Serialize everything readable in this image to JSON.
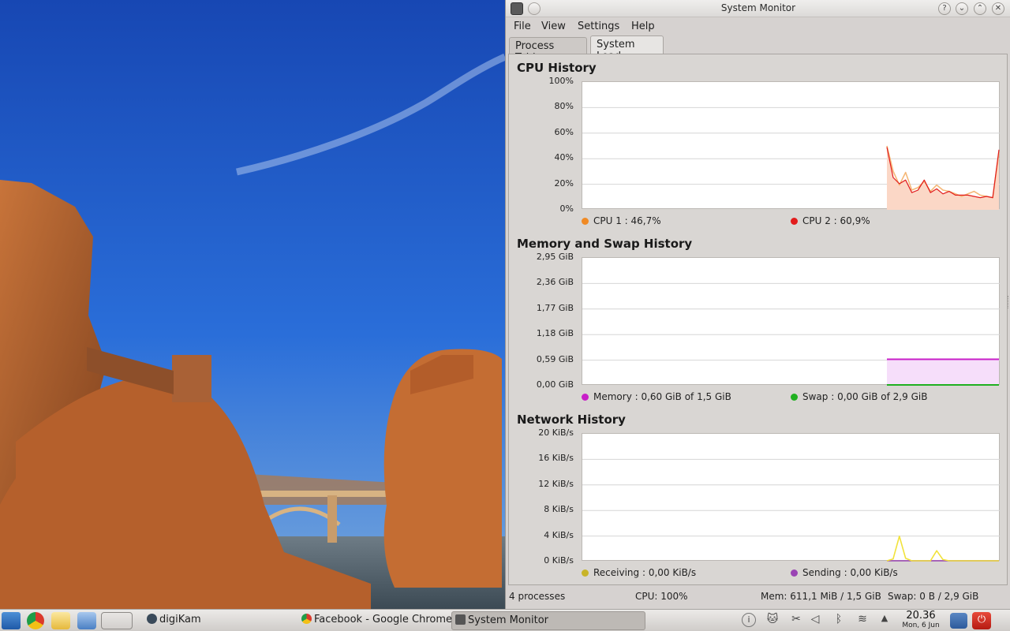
{
  "window": {
    "title": "System Monitor",
    "help_button": "?",
    "shade_button": "⌄",
    "maximize_button": "⌃",
    "close_button": "✕"
  },
  "menu": [
    "File",
    "View",
    "Settings",
    "Help"
  ],
  "tabs": [
    {
      "label": "Process Table",
      "active": false
    },
    {
      "label": "System Load",
      "active": true
    }
  ],
  "cpu": {
    "title": "CPU History",
    "ticks": [
      "100%",
      "80%",
      "60%",
      "40%",
      "20%",
      "0%"
    ],
    "legend": [
      {
        "label": "CPU 1 : 46,7%",
        "color": "#f08a24"
      },
      {
        "label": "CPU 2 : 60,9%",
        "color": "#e21c1c"
      }
    ]
  },
  "memory": {
    "title": "Memory and Swap History",
    "ticks": [
      "2,95 GiB",
      "2,36 GiB",
      "1,77 GiB",
      "1,18 GiB",
      "0,59 GiB",
      "0,00 GiB"
    ],
    "legend": [
      {
        "label": "Memory : 0,60 GiB of 1,5 GiB",
        "color": "#c81fc8"
      },
      {
        "label": "Swap : 0,00 GiB of 2,9 GiB",
        "color": "#20b020"
      }
    ]
  },
  "network": {
    "title": "Network History",
    "ticks": [
      "20 KiB/s",
      "16 KiB/s",
      "12 KiB/s",
      "8 KiB/s",
      "4 KiB/s",
      "0 KiB/s"
    ],
    "legend": [
      {
        "label": "Receiving : 0,00 KiB/s",
        "color": "#c8b428"
      },
      {
        "label": "Sending : 0,00 KiB/s",
        "color": "#9a44b4"
      }
    ]
  },
  "chart_data": [
    {
      "type": "line",
      "title": "CPU History",
      "ylim": [
        0,
        100
      ],
      "grid": true,
      "legend_position": "bottom",
      "series": [
        {
          "name": "CPU 1",
          "values": [
            50,
            30,
            19,
            29,
            15,
            17,
            22,
            14,
            19,
            15,
            14,
            12,
            10,
            12,
            14,
            11,
            10,
            9,
            45
          ]
        },
        {
          "name": "CPU 2",
          "values": [
            49,
            25,
            20,
            23,
            13,
            15,
            23,
            13,
            16,
            12,
            14,
            11,
            11,
            11,
            10,
            9,
            10,
            9,
            47
          ]
        }
      ]
    },
    {
      "type": "area",
      "title": "Memory and Swap History",
      "ylim": [
        0,
        2.95
      ],
      "grid": true,
      "legend_position": "bottom",
      "series": [
        {
          "name": "Memory",
          "values": [
            0.6,
            0.6,
            0.6,
            0.6,
            0.6,
            0.6,
            0.6,
            0.6
          ]
        },
        {
          "name": "Swap",
          "values": [
            0.0,
            0.0,
            0.0,
            0.0,
            0.0,
            0.0,
            0.0,
            0.0
          ]
        }
      ]
    },
    {
      "type": "line",
      "title": "Network History",
      "ylim": [
        0,
        20
      ],
      "grid": true,
      "legend_position": "bottom",
      "series": [
        {
          "name": "Receiving",
          "values": [
            0,
            0.3,
            3.9,
            0.4,
            0,
            0,
            0,
            0,
            1.6,
            0.2,
            0,
            0,
            0,
            0,
            0,
            0,
            0,
            0,
            0
          ]
        },
        {
          "name": "Sending",
          "values": [
            0,
            0,
            0,
            0,
            0,
            0,
            0,
            0,
            0,
            0,
            0,
            0,
            0,
            0,
            0,
            0,
            0,
            0,
            0
          ]
        }
      ]
    }
  ],
  "status": {
    "processes": "4 processes",
    "cpu": "CPU: 100%",
    "mem": "Mem: 611,1 MiB / 1,5 GiB",
    "swap": "Swap: 0 B / 2,9 GiB"
  },
  "taskbar": {
    "tasks": [
      {
        "label": "digiKam",
        "active": false
      },
      {
        "label": "Facebook - Google Chrome",
        "active": false
      },
      {
        "label": "System Monitor",
        "active": true
      }
    ],
    "clock_time": "20.36",
    "clock_date": "Mon, 6 Jun",
    "info_icon": "i"
  },
  "colors": {
    "accent_red": "#e21c1c",
    "cpu_fill": "#fbd7c6",
    "mem_fill": "#f6defa",
    "power_red": "#d41e1e"
  }
}
